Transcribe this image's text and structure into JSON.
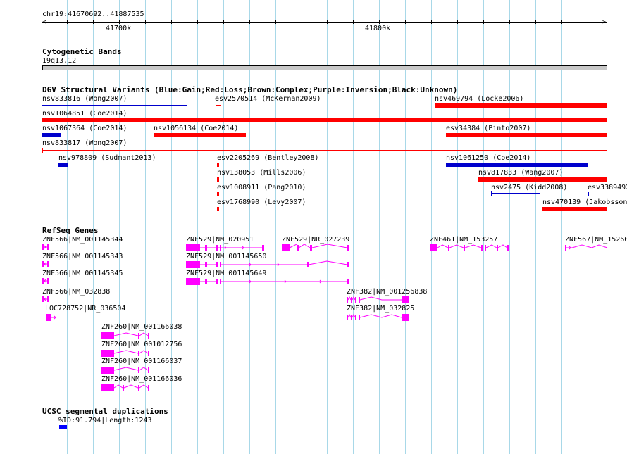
{
  "colors": {
    "gain": "#0000cc",
    "loss": "#ff0000",
    "gene": "#ff00ff",
    "segdup": "#0000ff",
    "grid": "#a8d8e8",
    "band": "#c8c8c8"
  },
  "header": {
    "coordinates": "chr19:41670692..41887535"
  },
  "ruler": {
    "ticks": [
      {
        "label": "41700k"
      },
      {
        "label": "41800k"
      }
    ]
  },
  "cytoband": {
    "title": "Cytogenetic Bands",
    "band_label": "19q13.12"
  },
  "dgv": {
    "title": "DGV Structural Variants (Blue:Gain;Red:Loss;Brown:Complex;Purple:Inversion;Black:Unknown)",
    "variants": [
      {
        "label": "nsv833816 (Wong2007)",
        "type": "gain"
      },
      {
        "label": "esv2570514 (McKernan2009)",
        "type": "loss"
      },
      {
        "label": "nsv469794 (Locke2006)",
        "type": "loss"
      },
      {
        "label": "nsv1064851 (Coe2014)",
        "type": "loss"
      },
      {
        "label": "nsv1067364 (Coe2014)",
        "type": "gain"
      },
      {
        "label": "nsv1056134 (Coe2014)",
        "type": "loss"
      },
      {
        "label": "esv34384 (Pinto2007)",
        "type": "loss"
      },
      {
        "label": "nsv833817 (Wong2007)",
        "type": "loss"
      },
      {
        "label": "nsv978809 (Sudmant2013)",
        "type": "gain"
      },
      {
        "label": "esv2205269 (Bentley2008)",
        "type": "loss"
      },
      {
        "label": "nsv1061250 (Coe2014)",
        "type": "gain"
      },
      {
        "label": "nsv138053 (Mills2006)",
        "type": "loss"
      },
      {
        "label": "nsv817833 (Wang2007)",
        "type": "loss"
      },
      {
        "label": "esv1008911 (Pang2010)",
        "type": "loss"
      },
      {
        "label": "nsv2475 (Kidd2008)",
        "type": "gain"
      },
      {
        "label": "esv3389492",
        "type": "gain"
      },
      {
        "label": "esv1768990 (Levy2007)",
        "type": "loss"
      },
      {
        "label": "nsv470139 (Jakobsson",
        "type": "loss"
      }
    ]
  },
  "refseq": {
    "title": "RefSeq Genes",
    "genes": [
      {
        "label": "ZNF566|NM_001145344"
      },
      {
        "label": "ZNF529|NM_020951"
      },
      {
        "label": "ZNF529|NR_027239"
      },
      {
        "label": "ZNF461|NM_153257"
      },
      {
        "label": "ZNF567|NM_15260"
      },
      {
        "label": "ZNF566|NM_001145343"
      },
      {
        "label": "ZNF529|NM_001145650"
      },
      {
        "label": "ZNF566|NM_001145345"
      },
      {
        "label": "ZNF529|NM_001145649"
      },
      {
        "label": "ZNF566|NM_032838"
      },
      {
        "label": "ZNF382|NM_001256838"
      },
      {
        "label": "LOC728752|NR_036504"
      },
      {
        "label": "ZNF382|NM_032825"
      },
      {
        "label": "ZNF260|NM_001166038"
      },
      {
        "label": "ZNF260|NM_001012756"
      },
      {
        "label": "ZNF260|NM_001166037"
      },
      {
        "label": "ZNF260|NM_001166036"
      }
    ]
  },
  "segdup": {
    "title": "UCSC segmental duplications",
    "items": [
      {
        "label": "%ID:91.794|Length:1243"
      }
    ]
  }
}
